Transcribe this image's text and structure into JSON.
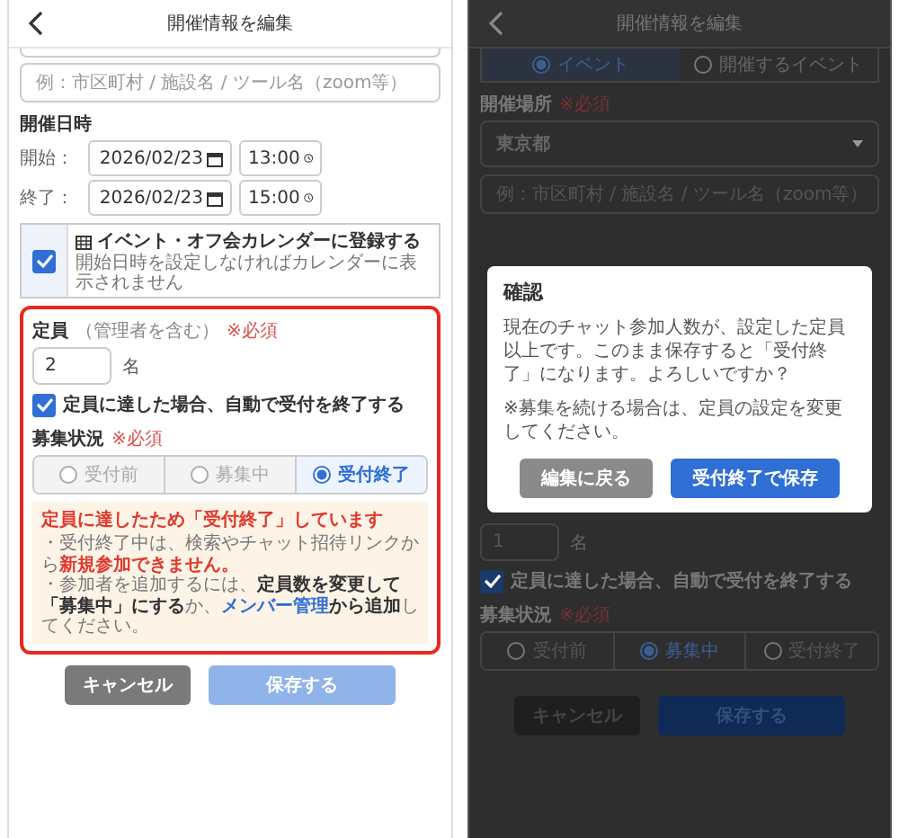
{
  "left_screen": {
    "header": {
      "title": "開催情報を編集"
    },
    "location_placeholder": "例：市区町村 / 施設名 / ツール名（zoom等）",
    "datetime": {
      "label": "開催日時",
      "rows": [
        {
          "label": "開始：",
          "date": "2026/02/23",
          "time": "13:00"
        },
        {
          "label": "終了：",
          "date": "2026/02/23",
          "time": "15:00"
        }
      ]
    },
    "calendar": {
      "checked": true,
      "label": "イベント・オフ会カレンダーに登録する",
      "note": "開始日時を設定しなければカレンダーに表示されません"
    },
    "capacity": {
      "highlighted": true,
      "label": "定員",
      "sub": "（管理者を含む）",
      "required": "※必須",
      "value": "2",
      "unit": "名"
    },
    "auto_close": {
      "checked": true,
      "label": "定員に達した場合、自動で受付を終了する"
    },
    "status": {
      "label": "募集状況",
      "required": "※必須",
      "options": [
        {
          "label": "受付前",
          "selected": false
        },
        {
          "label": "募集中",
          "selected": false
        },
        {
          "label": "受付終了",
          "selected": true
        }
      ]
    },
    "notice": {
      "title": "定員に達したため「受付終了」しています",
      "line_1": "・受付終了中は、検索やチャット招待リンクから**新規参加できません。**",
      "line_2": {
        "before": "・参加者を追加するには、**定員数を変更して「募集中」にする**か、",
        "link": "メンバー管理",
        "after": "**から追加**してください。"
      }
    },
    "buttons": [
      {
        "label": "キャンセル",
        "kind": "cancel",
        "disabled": false
      },
      {
        "label": "保存する",
        "kind": "primary",
        "disabled": true
      }
    ]
  },
  "right_screen": {
    "header": {
      "title": "開催情報を編集"
    },
    "event_type": [
      {
        "label": "イベント",
        "selected": true
      },
      {
        "label": "開催するイベント",
        "selected": false
      }
    ],
    "location": {
      "label": "開催場所",
      "required": "※必須",
      "prefecture": "東京都",
      "placeholder": "例：市区町村 / 施設名 / ツール名（zoom等）"
    },
    "capacity": {
      "value": "1",
      "unit": "名"
    },
    "auto_close": {
      "checked": true,
      "label": "定員に達した場合、自動で受付を終了する"
    },
    "status": {
      "label": "募集状況",
      "required": "※必須",
      "options": [
        {
          "label": "受付前",
          "selected": false
        },
        {
          "label": "募集中",
          "selected": true
        },
        {
          "label": "受付終了",
          "selected": false
        }
      ]
    },
    "buttons": [
      {
        "label": "キャンセル",
        "kind": "cancel",
        "disabled": false
      },
      {
        "label": "保存する",
        "kind": "primary",
        "disabled": true
      }
    ],
    "dialog": {
      "title": "確認",
      "message": "現在のチャット参加人数が、設定した定員以上です。このまま保存すると「受付終了」になります。よろしいですか？",
      "note": "※募集を続ける場合は、定員の設定を変更してください。",
      "buttons": [
        {
          "label": "編集に戻る",
          "kind": "secondary",
          "disabled": false
        },
        {
          "label": "受付終了で保存",
          "kind": "primary",
          "disabled": false
        }
      ]
    }
  }
}
